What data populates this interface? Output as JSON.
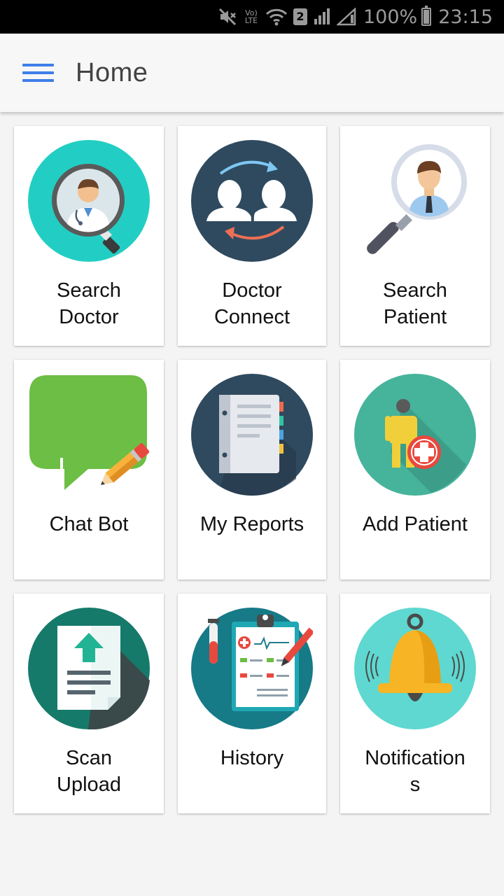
{
  "status_bar": {
    "lte_label": "Vo) LTE",
    "sim_label": "2",
    "battery_pct": "100%",
    "time": "23:15"
  },
  "app_bar": {
    "title": "Home",
    "menu_icon": "hamburger-menu-icon",
    "accent_color": "#3f7ee8"
  },
  "tiles": [
    {
      "label": "Search\nDoctor",
      "icon": "search-doctor-icon"
    },
    {
      "label": "Doctor\nConnect",
      "icon": "doctor-connect-icon"
    },
    {
      "label": "Search\nPatient",
      "icon": "search-patient-icon"
    },
    {
      "label": "Chat Bot",
      "icon": "chat-bot-icon"
    },
    {
      "label": "My Reports",
      "icon": "my-reports-icon"
    },
    {
      "label": "Add Patient",
      "icon": "add-patient-icon"
    },
    {
      "label": "Scan\nUpload",
      "icon": "scan-upload-icon"
    },
    {
      "label": "History",
      "icon": "history-icon"
    },
    {
      "label": "Notification\ns",
      "icon": "notifications-icon"
    }
  ]
}
